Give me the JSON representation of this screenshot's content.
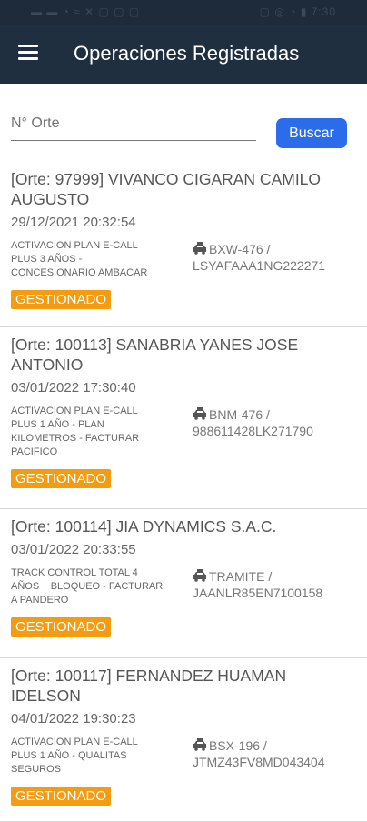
{
  "status_bar": {
    "left_text": "▬ ▬ ◔ ≈ ✕ ▢ ▢ ▢",
    "right_text": "▢ ◎ ◔ ▮ 7:30"
  },
  "app_bar": {
    "title": "Operaciones Registradas"
  },
  "search": {
    "placeholder": "N° Orte",
    "button_label": "Buscar"
  },
  "colors": {
    "app_bar": "#1f2f40",
    "accent": "#2a6ce9",
    "badge": "#f49b10"
  },
  "orders": [
    {
      "title": "[Orte: 97999] VIVANCO CIGARAN CAMILO AUGUSTO",
      "date": "29/12/2021 20:32:54",
      "description": "ACTIVACION PLAN E-CALL PLUS 3 AÑOS - CONCESIONARIO AMBACAR",
      "vehicle": "BXW-476 / LSYAFAAA1NG222271",
      "status": "GESTIONADO"
    },
    {
      "title": "[Orte: 100113] SANABRIA YANES JOSE ANTONIO",
      "date": "03/01/2022 17:30:40",
      "description": "ACTIVACION PLAN E-CALL PLUS 1 AÑO - PLAN KILOMETROS - FACTURAR PACIFICO",
      "vehicle": "BNM-476 / 988611428LK271790",
      "status": "GESTIONADO"
    },
    {
      "title": "[Orte: 100114] JIA DYNAMICS S.A.C.",
      "date": "03/01/2022 20:33:55",
      "description": "TRACK CONTROL TOTAL 4 AÑOS + BLOQUEO - FACTURAR A PANDERO",
      "vehicle": "TRAMITE / JAANLR85EN7100158",
      "status": "GESTIONADO"
    },
    {
      "title": "[Orte: 100117] FERNANDEZ HUAMAN IDELSON",
      "date": "04/01/2022 19:30:23",
      "description": "ACTIVACION PLAN E-CALL PLUS 1 AÑO - QUALITAS SEGUROS",
      "vehicle": "BSX-196 / JTMZ43FV8MD043404",
      "status": "GESTIONADO"
    }
  ]
}
